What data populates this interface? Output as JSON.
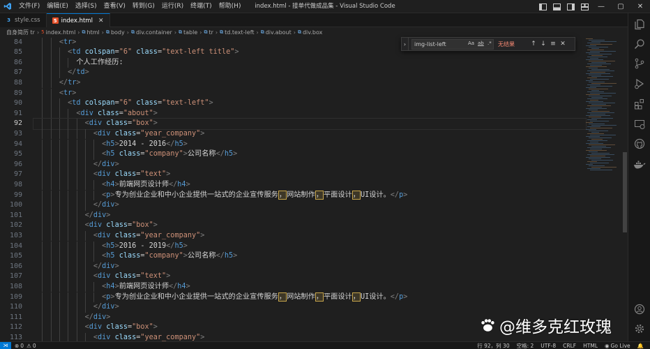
{
  "titlebar": {
    "menu": [
      "文件(F)",
      "编辑(E)",
      "选择(S)",
      "查看(V)",
      "转到(G)",
      "运行(R)",
      "终端(T)",
      "帮助(H)"
    ],
    "window_title": "index.html - 接单代做成品集 - Visual Studio Code"
  },
  "tabs": [
    {
      "label": "style.css",
      "icon": "css-file-icon",
      "active": false
    },
    {
      "label": "index.html",
      "icon": "html-file-icon",
      "active": true
    }
  ],
  "breadcrumb": [
    "自身简历 tr",
    "index.html",
    "html",
    "body",
    "div.container",
    "table",
    "tr",
    "td.text-left",
    "div.about",
    "div.box"
  ],
  "find": {
    "value": "img-list-left",
    "match_case": "Aa",
    "whole_word": "ab",
    "regex": ".*",
    "result": "无结果"
  },
  "editor": {
    "current_line": 92,
    "lines": [
      {
        "n": 84,
        "tokens": [
          [
            "p",
            "<"
          ],
          [
            "t",
            "tr"
          ],
          [
            "p",
            ">"
          ]
        ],
        "indent": 3
      },
      {
        "n": 85,
        "tokens": [
          [
            "p",
            "<"
          ],
          [
            "t",
            "td"
          ],
          [
            "x",
            " "
          ],
          [
            "a",
            "colspan"
          ],
          [
            "e",
            "="
          ],
          [
            "s",
            "\"6\""
          ],
          [
            "x",
            " "
          ],
          [
            "a",
            "class"
          ],
          [
            "e",
            "="
          ],
          [
            "s",
            "\"text-left title\""
          ],
          [
            "p",
            ">"
          ]
        ],
        "indent": 4
      },
      {
        "n": 86,
        "tokens": [
          [
            "x",
            "个人工作经历:"
          ]
        ],
        "indent": 5
      },
      {
        "n": 87,
        "tokens": [
          [
            "p",
            "</"
          ],
          [
            "t",
            "td"
          ],
          [
            "p",
            ">"
          ]
        ],
        "indent": 4
      },
      {
        "n": 88,
        "tokens": [
          [
            "p",
            "</"
          ],
          [
            "t",
            "tr"
          ],
          [
            "p",
            ">"
          ]
        ],
        "indent": 3
      },
      {
        "n": 89,
        "tokens": [
          [
            "p",
            "<"
          ],
          [
            "t",
            "tr"
          ],
          [
            "p",
            ">"
          ]
        ],
        "indent": 3
      },
      {
        "n": 90,
        "tokens": [
          [
            "p",
            "<"
          ],
          [
            "t",
            "td"
          ],
          [
            "x",
            " "
          ],
          [
            "a",
            "colspan"
          ],
          [
            "e",
            "="
          ],
          [
            "s",
            "\"6\""
          ],
          [
            "x",
            " "
          ],
          [
            "a",
            "class"
          ],
          [
            "e",
            "="
          ],
          [
            "s",
            "\"text-left\""
          ],
          [
            "p",
            ">"
          ]
        ],
        "indent": 4
      },
      {
        "n": 91,
        "tokens": [
          [
            "p",
            "<"
          ],
          [
            "t",
            "div"
          ],
          [
            "x",
            " "
          ],
          [
            "a",
            "class"
          ],
          [
            "e",
            "="
          ],
          [
            "s",
            "\"about\""
          ],
          [
            "p",
            ">"
          ]
        ],
        "indent": 5
      },
      {
        "n": 92,
        "tokens": [
          [
            "p",
            "<"
          ],
          [
            "t",
            "div"
          ],
          [
            "x",
            " "
          ],
          [
            "a",
            "class"
          ],
          [
            "e",
            "="
          ],
          [
            "s",
            "\"box\""
          ],
          [
            "p",
            ">"
          ]
        ],
        "indent": 6
      },
      {
        "n": 93,
        "tokens": [
          [
            "p",
            "<"
          ],
          [
            "t",
            "div"
          ],
          [
            "x",
            " "
          ],
          [
            "a",
            "class"
          ],
          [
            "e",
            "="
          ],
          [
            "s",
            "\"year_company\""
          ],
          [
            "p",
            ">"
          ]
        ],
        "indent": 7
      },
      {
        "n": 94,
        "tokens": [
          [
            "p",
            "<"
          ],
          [
            "t",
            "h5"
          ],
          [
            "p",
            ">"
          ],
          [
            "x",
            "2014 - 2016"
          ],
          [
            "p",
            "</"
          ],
          [
            "t",
            "h5"
          ],
          [
            "p",
            ">"
          ]
        ],
        "indent": 8
      },
      {
        "n": 95,
        "tokens": [
          [
            "p",
            "<"
          ],
          [
            "t",
            "h5"
          ],
          [
            "x",
            " "
          ],
          [
            "a",
            "class"
          ],
          [
            "e",
            "="
          ],
          [
            "s",
            "\"company\""
          ],
          [
            "p",
            ">"
          ],
          [
            "x",
            "公司名称"
          ],
          [
            "p",
            "</"
          ],
          [
            "t",
            "h5"
          ],
          [
            "p",
            ">"
          ]
        ],
        "indent": 8
      },
      {
        "n": 96,
        "tokens": [
          [
            "p",
            "</"
          ],
          [
            "t",
            "div"
          ],
          [
            "p",
            ">"
          ]
        ],
        "indent": 7
      },
      {
        "n": 97,
        "tokens": [
          [
            "p",
            "<"
          ],
          [
            "t",
            "div"
          ],
          [
            "x",
            " "
          ],
          [
            "a",
            "class"
          ],
          [
            "e",
            "="
          ],
          [
            "s",
            "\"text\""
          ],
          [
            "p",
            ">"
          ]
        ],
        "indent": 7
      },
      {
        "n": 98,
        "tokens": [
          [
            "p",
            "<"
          ],
          [
            "t",
            "h4"
          ],
          [
            "p",
            ">"
          ],
          [
            "x",
            "前端网页设计师"
          ],
          [
            "p",
            "</"
          ],
          [
            "t",
            "h4"
          ],
          [
            "p",
            ">"
          ]
        ],
        "indent": 8
      },
      {
        "n": 99,
        "tokens": [
          [
            "p",
            "<"
          ],
          [
            "t",
            "p"
          ],
          [
            "p",
            ">"
          ],
          [
            "x",
            "专为创业企业和中小企业提供一站式的企业宣传服务"
          ],
          [
            "h",
            "，"
          ],
          [
            "x",
            "网站制作"
          ],
          [
            "h",
            "，"
          ],
          [
            "x",
            "平面设计"
          ],
          [
            "h",
            "，"
          ],
          [
            "x",
            "UI设计。"
          ],
          [
            "p",
            "</"
          ],
          [
            "t",
            "p"
          ],
          [
            "p",
            ">"
          ]
        ],
        "indent": 8
      },
      {
        "n": 100,
        "tokens": [
          [
            "p",
            "</"
          ],
          [
            "t",
            "div"
          ],
          [
            "p",
            ">"
          ]
        ],
        "indent": 7
      },
      {
        "n": 101,
        "tokens": [
          [
            "p",
            "</"
          ],
          [
            "t",
            "div"
          ],
          [
            "p",
            ">"
          ]
        ],
        "indent": 6
      },
      {
        "n": 102,
        "tokens": [
          [
            "p",
            "<"
          ],
          [
            "t",
            "div"
          ],
          [
            "x",
            " "
          ],
          [
            "a",
            "class"
          ],
          [
            "e",
            "="
          ],
          [
            "s",
            "\"box\""
          ],
          [
            "p",
            ">"
          ]
        ],
        "indent": 6
      },
      {
        "n": 103,
        "tokens": [
          [
            "p",
            "<"
          ],
          [
            "t",
            "div"
          ],
          [
            "x",
            " "
          ],
          [
            "a",
            "class"
          ],
          [
            "e",
            "="
          ],
          [
            "s",
            "\"year_company\""
          ],
          [
            "p",
            ">"
          ]
        ],
        "indent": 7
      },
      {
        "n": 104,
        "tokens": [
          [
            "p",
            "<"
          ],
          [
            "t",
            "h5"
          ],
          [
            "p",
            ">"
          ],
          [
            "x",
            "2016 - 2019"
          ],
          [
            "p",
            "</"
          ],
          [
            "t",
            "h5"
          ],
          [
            "p",
            ">"
          ]
        ],
        "indent": 8
      },
      {
        "n": 105,
        "tokens": [
          [
            "p",
            "<"
          ],
          [
            "t",
            "h5"
          ],
          [
            "x",
            " "
          ],
          [
            "a",
            "class"
          ],
          [
            "e",
            "="
          ],
          [
            "s",
            "\"company\""
          ],
          [
            "p",
            ">"
          ],
          [
            "x",
            "公司名称"
          ],
          [
            "p",
            "</"
          ],
          [
            "t",
            "h5"
          ],
          [
            "p",
            ">"
          ]
        ],
        "indent": 8
      },
      {
        "n": 106,
        "tokens": [
          [
            "p",
            "</"
          ],
          [
            "t",
            "div"
          ],
          [
            "p",
            ">"
          ]
        ],
        "indent": 7
      },
      {
        "n": 107,
        "tokens": [
          [
            "p",
            "<"
          ],
          [
            "t",
            "div"
          ],
          [
            "x",
            " "
          ],
          [
            "a",
            "class"
          ],
          [
            "e",
            "="
          ],
          [
            "s",
            "\"text\""
          ],
          [
            "p",
            ">"
          ]
        ],
        "indent": 7
      },
      {
        "n": 108,
        "tokens": [
          [
            "p",
            "<"
          ],
          [
            "t",
            "h4"
          ],
          [
            "p",
            ">"
          ],
          [
            "x",
            "前端网页设计师"
          ],
          [
            "p",
            "</"
          ],
          [
            "t",
            "h4"
          ],
          [
            "p",
            ">"
          ]
        ],
        "indent": 8
      },
      {
        "n": 109,
        "tokens": [
          [
            "p",
            "<"
          ],
          [
            "t",
            "p"
          ],
          [
            "p",
            ">"
          ],
          [
            "x",
            "专为创业企业和中小企业提供一站式的企业宣传服务"
          ],
          [
            "h",
            "，"
          ],
          [
            "x",
            "网站制作"
          ],
          [
            "h",
            "，"
          ],
          [
            "x",
            "平面设计"
          ],
          [
            "h",
            "，"
          ],
          [
            "x",
            "UI设计。"
          ],
          [
            "p",
            "</"
          ],
          [
            "t",
            "p"
          ],
          [
            "p",
            ">"
          ]
        ],
        "indent": 8
      },
      {
        "n": 110,
        "tokens": [
          [
            "p",
            "</"
          ],
          [
            "t",
            "div"
          ],
          [
            "p",
            ">"
          ]
        ],
        "indent": 7
      },
      {
        "n": 111,
        "tokens": [
          [
            "p",
            "</"
          ],
          [
            "t",
            "div"
          ],
          [
            "p",
            ">"
          ]
        ],
        "indent": 6
      },
      {
        "n": 112,
        "tokens": [
          [
            "p",
            "<"
          ],
          [
            "t",
            "div"
          ],
          [
            "x",
            " "
          ],
          [
            "a",
            "class"
          ],
          [
            "e",
            "="
          ],
          [
            "s",
            "\"box\""
          ],
          [
            "p",
            ">"
          ]
        ],
        "indent": 6
      },
      {
        "n": 113,
        "tokens": [
          [
            "p",
            "<"
          ],
          [
            "t",
            "div"
          ],
          [
            "x",
            " "
          ],
          [
            "a",
            "class"
          ],
          [
            "e",
            "="
          ],
          [
            "s",
            "\"year_company\""
          ],
          [
            "p",
            ">"
          ]
        ],
        "indent": 7
      }
    ]
  },
  "statusbar": {
    "errors": "0",
    "warnings": "0",
    "position": "行 92，列 30",
    "spaces": "空格: 2",
    "encoding": "UTF-8",
    "eol": "CRLF",
    "language": "HTML",
    "golive": "Go Live"
  },
  "watermark": "@维多克红玫瑰",
  "colors": {
    "accent": "#0078d4",
    "tag": "#569cd6",
    "attribute": "#9cdcfe",
    "string": "#ce9178",
    "punctuation": "#808080",
    "highlight_border": "#c8a64b",
    "no_results": "#f48771"
  }
}
